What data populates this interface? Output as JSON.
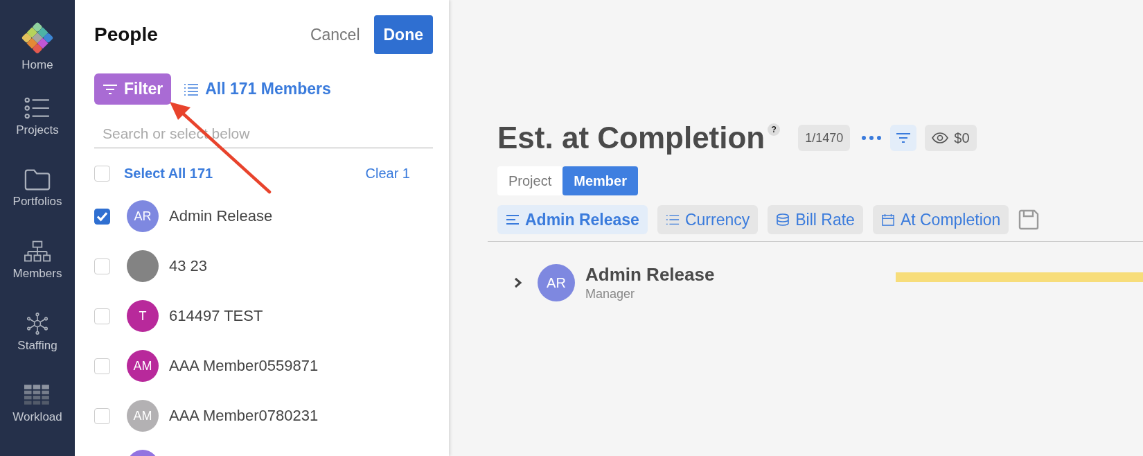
{
  "sidebar": {
    "items": [
      {
        "label": "Home",
        "kind": "logo"
      },
      {
        "label": "Projects",
        "kind": "list"
      },
      {
        "label": "Portfolios",
        "kind": "folder"
      },
      {
        "label": "Members",
        "kind": "org"
      },
      {
        "label": "Staffing",
        "kind": "hub"
      },
      {
        "label": "Workload",
        "kind": "grid"
      }
    ]
  },
  "panel": {
    "title": "People",
    "cancel": "Cancel",
    "done": "Done",
    "filter": "Filter",
    "all_members": "All 171 Members",
    "search": {
      "placeholder": "Search or select below"
    },
    "select_all": {
      "label": "Select All 171",
      "checked": false
    },
    "clear": "Clear 1",
    "members": [
      {
        "initials": "AR",
        "name": "Admin Release",
        "color": "#7e88e0",
        "checked": true
      },
      {
        "name": "43 23",
        "color": "#838383",
        "checked": false
      },
      {
        "initials": "T",
        "name": "614497 TEST",
        "color": "#b8299b",
        "checked": false
      },
      {
        "initials": "AM",
        "name": "AAA Member0559871",
        "color": "#b8299b",
        "checked": false
      },
      {
        "initials": "AM",
        "name": "AAA Member0780231",
        "color": "#b3b1b3",
        "checked": false
      },
      {
        "color": "#9273e0"
      }
    ]
  },
  "main": {
    "title": "Est. at Completion",
    "help": "?",
    "counter": "1/1470",
    "budget": "$0",
    "view_toggle": [
      {
        "label": "Project",
        "selected": false
      },
      {
        "label": "Member",
        "selected": true
      }
    ],
    "chips": [
      {
        "label": "Admin Release",
        "kind": "lines",
        "selected": true
      },
      {
        "label": "Currency",
        "kind": "list",
        "selected": false
      },
      {
        "label": "Bill Rate",
        "kind": "stack",
        "selected": false
      },
      {
        "label": "At Completion",
        "kind": "calendar",
        "selected": false
      }
    ],
    "rows": [
      {
        "initials": "AR",
        "name": "Admin Release",
        "role": "Manager",
        "color": "#7e88e0",
        "expanded": false
      }
    ]
  }
}
